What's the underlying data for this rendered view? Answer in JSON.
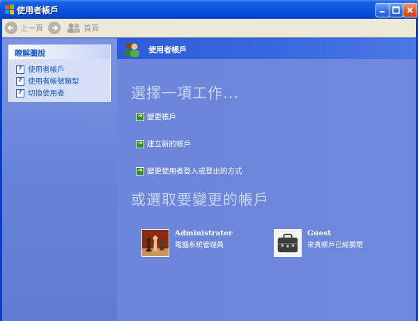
{
  "window": {
    "title": "使用者帳戶"
  },
  "toolbar": {
    "back_label": "上一頁",
    "home_label": "首頁"
  },
  "help": {
    "heading": "瞭解圖說",
    "items": [
      {
        "label": "使用者帳戶"
      },
      {
        "label": "使用者帳號類型"
      },
      {
        "label": "切換使用者"
      }
    ]
  },
  "header": {
    "title": "使用者帳戶"
  },
  "main": {
    "pick_task": "選擇一項工作...",
    "tasks": [
      {
        "label": "變更帳戶"
      },
      {
        "label": "建立新的帳戶"
      },
      {
        "label": "變更使用者登入或登出的方式"
      }
    ],
    "pick_account": "或選取要變更的帳戶",
    "accounts": [
      {
        "name": "Administrator",
        "description": "電腦系統管理員",
        "picture": "chess-pieces-icon"
      },
      {
        "name": "Guest",
        "description": "來賓帳戶已經關閉",
        "picture": "briefcase-icon"
      }
    ]
  },
  "colors": {
    "title_bar": "#0a54dc",
    "pane_background": "#6b86d9",
    "header_bar": "#2d5bd8",
    "link_blue": "#215dc6",
    "task_arrow": "#2d8a2d"
  }
}
